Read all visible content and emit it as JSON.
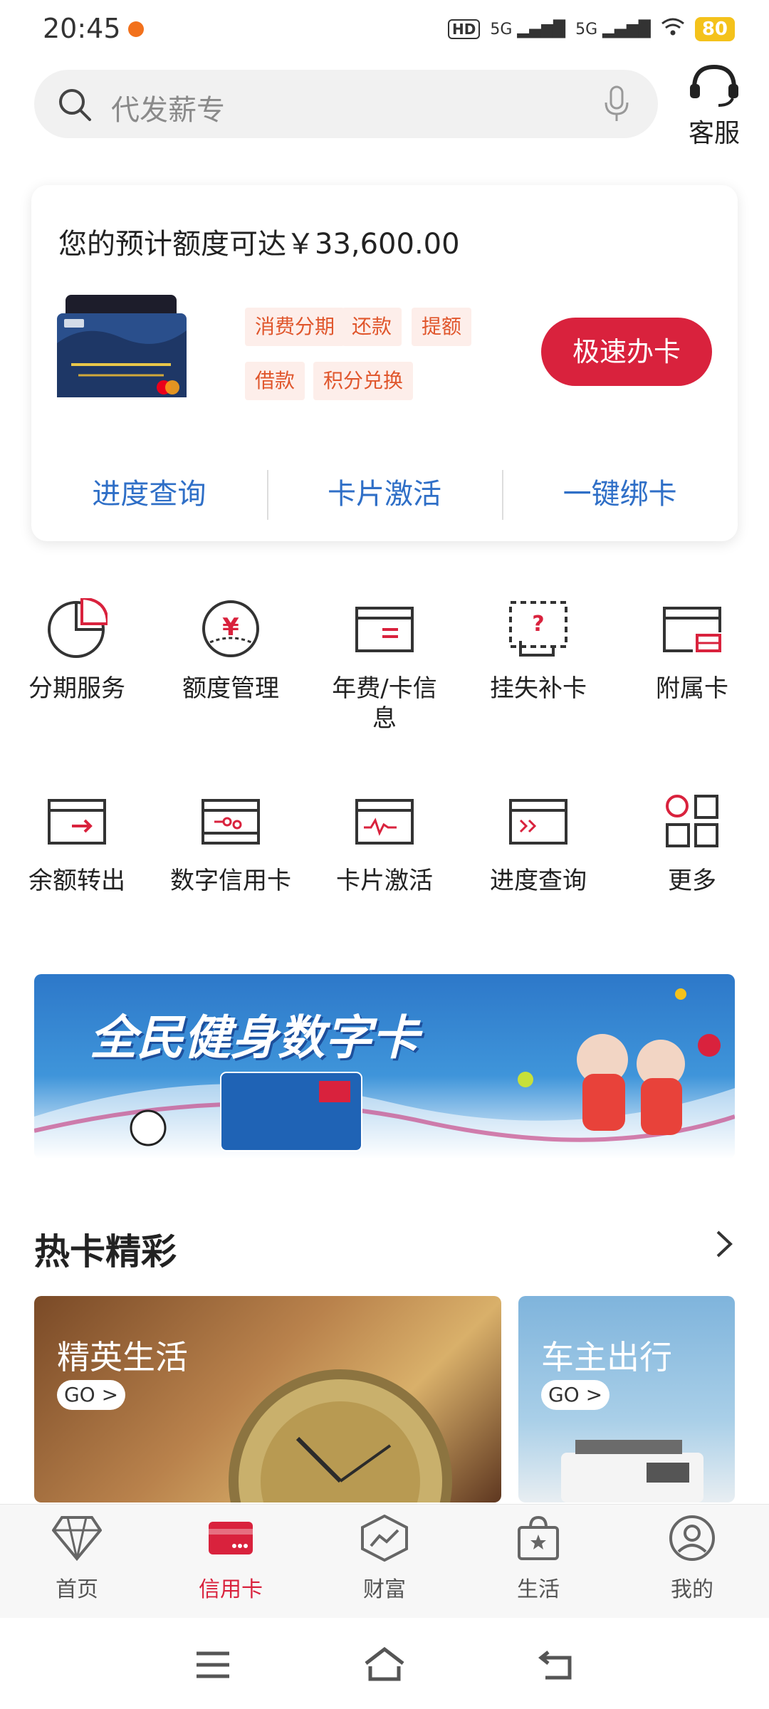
{
  "status_bar": {
    "time": "20:45",
    "network": "5G",
    "battery": "80"
  },
  "search": {
    "placeholder": "代发薪专"
  },
  "customer_service": {
    "label": "客服"
  },
  "credit_panel": {
    "headline": "您的预计额度可达￥33,600.00",
    "tags": [
      "消费分期",
      "还款",
      "提额",
      "借款",
      "积分兑换"
    ],
    "apply_button": "极速办卡",
    "links": [
      "进度查询",
      "卡片激活",
      "一键绑卡"
    ]
  },
  "services": [
    {
      "label": "分期服务",
      "icon": "pie-chart-icon"
    },
    {
      "label": "额度管理",
      "icon": "yen-gauge-icon"
    },
    {
      "label": "年费/卡信息",
      "icon": "card-info-icon"
    },
    {
      "label": "挂失补卡",
      "icon": "lost-card-icon"
    },
    {
      "label": "附属卡",
      "icon": "supplementary-card-icon"
    },
    {
      "label": "余额转出",
      "icon": "balance-transfer-icon"
    },
    {
      "label": "数字信用卡",
      "icon": "digital-card-icon"
    },
    {
      "label": "卡片激活",
      "icon": "card-activate-icon"
    },
    {
      "label": "进度查询",
      "icon": "progress-card-icon"
    },
    {
      "label": "更多",
      "icon": "more-grid-icon"
    }
  ],
  "banner": {
    "title": "全民健身数字卡"
  },
  "hot_cards": {
    "title": "热卡精彩",
    "items": [
      {
        "title": "精英生活",
        "go": "GO >"
      },
      {
        "title": "车主出行",
        "go": "GO >"
      }
    ]
  },
  "bottom_nav": {
    "items": [
      {
        "label": "首页",
        "icon": "diamond-icon"
      },
      {
        "label": "信用卡",
        "icon": "credit-card-icon"
      },
      {
        "label": "财富",
        "icon": "wealth-chart-icon"
      },
      {
        "label": "生活",
        "icon": "shopping-bag-icon"
      },
      {
        "label": "我的",
        "icon": "user-icon"
      }
    ],
    "active": "信用卡"
  },
  "colors": {
    "brand_red": "#d9223d",
    "link_blue": "#2f6fc7",
    "tag_text": "#e0562c"
  }
}
